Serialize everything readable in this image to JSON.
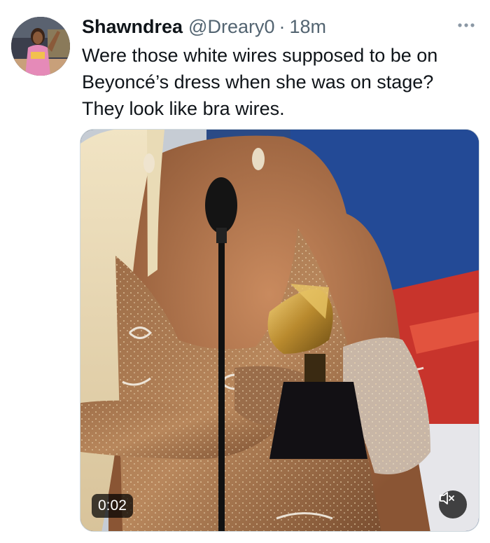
{
  "tweet": {
    "author_name": "Shawndrea",
    "handle": "@Dreary0",
    "separator": "·",
    "time": "18m",
    "text_lines": [
      "Were those white wires supposed to be on",
      "Beyoncé’s dress when she was on stage?",
      "They look like bra wires."
    ]
  },
  "video": {
    "timestamp": "0:02",
    "mute_icon": "speaker-muted-icon"
  },
  "icons": {
    "more": "more-dots-icon",
    "avatar": "avatar"
  },
  "colors": {
    "text": "#0f1419",
    "secondary": "#536471"
  }
}
